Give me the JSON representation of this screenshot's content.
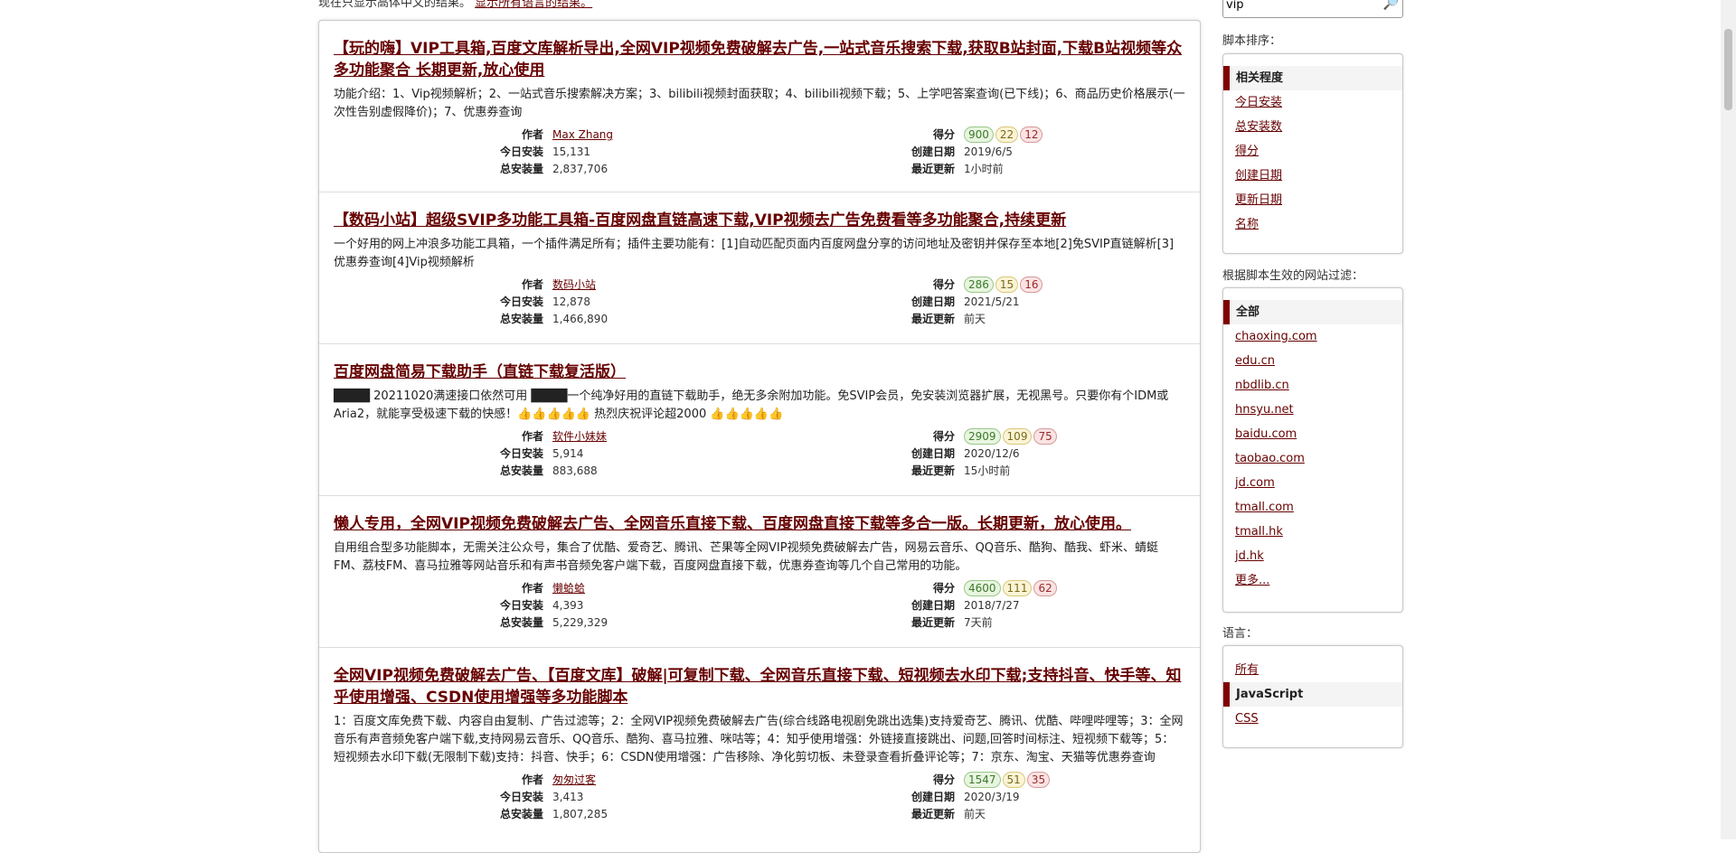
{
  "top_note": {
    "text": "现在只显示高体中文的结果。",
    "link": "显示所有语言的结果。"
  },
  "results": [
    {
      "title": "【玩的嗨】VIP工具箱,百度文库解析导出,全网VIP视频免费破解去广告,一站式音乐搜索下载,获取B站封面,下载B站视频等众多功能聚合 长期更新,放心使用",
      "desc": "功能介绍：1、Vip视频解析；2、一站式音乐搜索解决方案；3、bilibili视频封面获取；4、bilibili视频下载；5、上学吧答案查询(已下线)；6、商品历史价格展示(一次性告别虚假降价)；7、优惠券查询",
      "author": "Max Zhang",
      "daily": "15,131",
      "total": "2,837,706",
      "scores": [
        "900",
        "22",
        "12"
      ],
      "created": "2019/6/5",
      "updated": "1小时前"
    },
    {
      "title": "【数码小站】超级SVIP多功能工具箱-百度网盘直链高速下载,VIP视频去广告免费看等多功能聚合,持续更新",
      "desc": "一个好用的网上冲浪多功能工具箱，一个插件满足所有；插件主要功能有：[1]自动匹配页面内百度网盘分享的访问地址及密钥并保存至本地[2]免SVIP直链解析[3]优惠券查询[4]Vip视频解析",
      "author": "数码小站",
      "daily": "12,878",
      "total": "1,466,890",
      "scores": [
        "286",
        "15",
        "16"
      ],
      "created": "2021/5/21",
      "updated": "前天"
    },
    {
      "title": "百度网盘简易下载助手（直链下载复活版）",
      "desc": "████ 20211020满速接口依然可用 ████一个纯净好用的直链下载助手，绝无多余附加功能。免SVIP会员，免安装浏览器扩展，无视黑号。只要你有个IDM或Aria2，就能享受极速下载的快感！👍👍👍👍👍 热烈庆祝评论超2000 👍👍👍👍👍",
      "author": "软件小妹妹",
      "daily": "5,914",
      "total": "883,688",
      "scores": [
        "2909",
        "109",
        "75"
      ],
      "created": "2020/12/6",
      "updated": "15小时前"
    },
    {
      "title": "懒人专用，全网VIP视频免费破解去广告、全网音乐直接下载、百度网盘直接下载等多合一版。长期更新，放心使用。",
      "desc": "自用组合型多功能脚本，无需关注公众号，集合了优酷、爱奇艺、腾讯、芒果等全网VIP视频免费破解去广告，网易云音乐、QQ音乐、酷狗、酷我、虾米、蜻蜓FM、荔枝FM、喜马拉雅等网站音乐和有声书音频免客户端下载，百度网盘直接下载，优惠券查询等几个自己常用的功能。",
      "author": "懒蛤蛤",
      "daily": "4,393",
      "total": "5,229,329",
      "scores": [
        "4600",
        "111",
        "62"
      ],
      "created": "2018/7/27",
      "updated": "7天前"
    },
    {
      "title": "全网VIP视频免费破解去广告、【百度文库】破解|可复制下载、全网音乐直接下载、短视频去水印下载;支持抖音、快手等、知乎使用增强、CSDN使用增强等多功能脚本",
      "desc": "1：百度文库免费下载、内容自由复制、广告过滤等；2：全网VIP视频免费破解去广告(综合线路电视剧免跳出选集)支持爱奇艺、腾讯、优酷、哔哩哔哩等；3：全网音乐有声音频免客户端下载,支持网易云音乐、QQ音乐、酷狗、喜马拉雅、咪咕等；4：知乎使用增强：外链接直接跳出、问题,回答时间标注、短视频下载等；5：短视频去水印下载(无限制下载)支持：抖音、快手；6：CSDN使用增强：广告移除、净化剪切板、未登录查看折叠评论等；7：京东、淘宝、天猫等优惠券查询",
      "author": "匆匆过客",
      "daily": "3,413",
      "total": "1,807,285",
      "scores": [
        "1547",
        "51",
        "35"
      ],
      "created": "2020/3/19",
      "updated": "前天"
    }
  ],
  "meta_labels": {
    "author": "作者",
    "daily": "今日安装",
    "total": "总安装量",
    "score": "得分",
    "created": "创建日期",
    "updated": "最近更新"
  },
  "sidebar": {
    "search_value": "vip",
    "sort_label": "脚本排序：",
    "sort_items": [
      "相关程度",
      "今日安装",
      "总安装数",
      "得分",
      "创建日期",
      "更新日期",
      "名称"
    ],
    "site_label": "根据脚本生效的网站过滤：",
    "site_items": [
      "全部",
      "chaoxing.com",
      "edu.cn",
      "nbdlib.cn",
      "hnsyu.net",
      "baidu.com",
      "taobao.com",
      "jd.com",
      "tmall.com",
      "tmall.hk",
      "jd.hk",
      "更多..."
    ],
    "lang_label": "语言：",
    "lang_items": [
      "所有",
      "JavaScript",
      "CSS"
    ]
  },
  "colors": {
    "accent": "#670000",
    "active_bar": "#800000",
    "score_good": "#3a7a2a",
    "score_ok": "#7a6a1a",
    "score_bad": "#9a2a2a"
  }
}
